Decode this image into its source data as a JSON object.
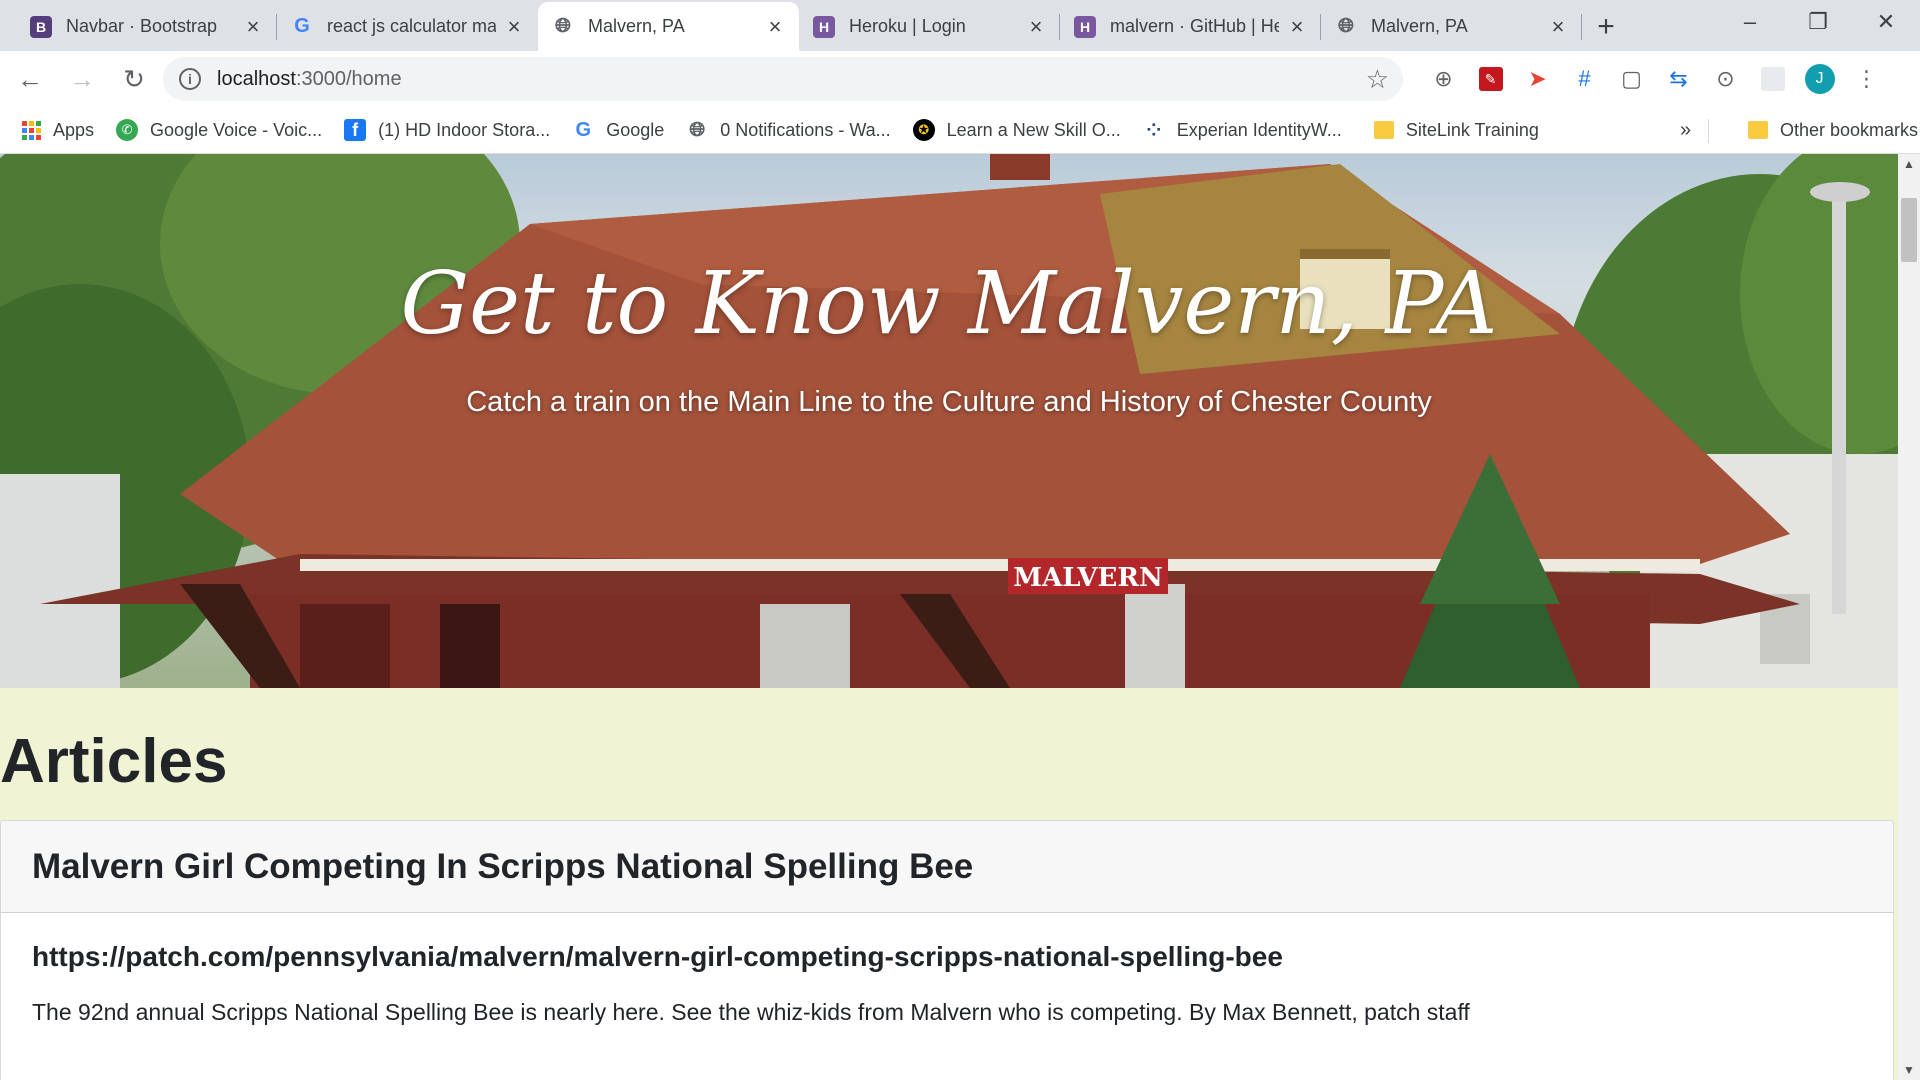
{
  "tabs": [
    {
      "title": "Navbar · Bootstrap",
      "favicon": "B",
      "icon": "bootstrap-icon",
      "active": false
    },
    {
      "title": "react js calculator ma",
      "favicon": "G",
      "icon": "google-icon",
      "active": false
    },
    {
      "title": "Malvern, PA",
      "favicon": "globe",
      "icon": "globe-icon",
      "active": true
    },
    {
      "title": "Heroku | Login",
      "favicon": "H",
      "icon": "heroku-icon",
      "active": false
    },
    {
      "title": "malvern · GitHub | He",
      "favicon": "H",
      "icon": "heroku-icon",
      "active": false
    },
    {
      "title": "Malvern, PA",
      "favicon": "globe",
      "icon": "globe-icon",
      "active": false
    }
  ],
  "address_bar": {
    "host": "localhost",
    "path": ":3000/home"
  },
  "profile": {
    "initial": "J",
    "color": "#129eaf"
  },
  "bookmarks": [
    {
      "label": "Apps",
      "icon": "apps-icon"
    },
    {
      "label": "Google Voice - Voic...",
      "icon": "google-voice-icon"
    },
    {
      "label": "(1) HD Indoor Stora...",
      "icon": "facebook-icon"
    },
    {
      "label": "Google",
      "icon": "google-icon"
    },
    {
      "label": "0 Notifications - Wa...",
      "icon": "globe-icon"
    },
    {
      "label": "Learn a New Skill O...",
      "icon": "learn-icon"
    },
    {
      "label": "Experian IdentityW...",
      "icon": "experian-icon"
    },
    {
      "label": "SiteLink Training",
      "icon": "folder-icon"
    }
  ],
  "bookmarks_more": "»",
  "other_bookmarks": "Other bookmarks",
  "hero": {
    "title": "Get to Know Malvern, PA",
    "subtitle": "Catch a train on the Main Line to the Culture and History of Chester County",
    "sign_text": "MALVERN"
  },
  "articles": {
    "heading": "Articles",
    "items": [
      {
        "title": "Malvern Girl Competing In Scripps National Spelling Bee",
        "link": "https://patch.com/pennsylvania/malvern/malvern-girl-competing-scripps-national-spelling-bee",
        "description": "The 92nd annual Scripps National Spelling Bee is nearly here. See the whiz-kids from Malvern who is competing. By Max Bennett, patch staff"
      }
    ]
  },
  "colors": {
    "section_bg": "#f1f4d4",
    "roof": "#a4523a",
    "sign": "#b3262a"
  }
}
